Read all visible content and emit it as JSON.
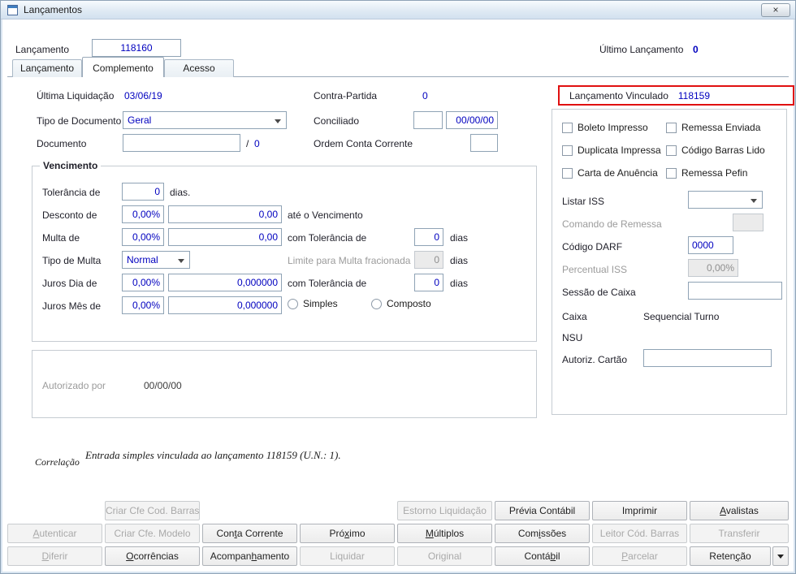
{
  "window": {
    "title": "Lançamentos",
    "close_glyph": "×"
  },
  "header": {
    "lancamento_label": "Lançamento",
    "lancamento_value": "118160",
    "ultimo_label": "Último Lançamento",
    "ultimo_value": "0"
  },
  "tabs": [
    {
      "label": "Lançamento"
    },
    {
      "label": "Complemento"
    },
    {
      "label": "Acesso"
    }
  ],
  "general": {
    "ultima_liquidacao_label": "Última Liquidação",
    "ultima_liquidacao_value": "03/06/19",
    "contra_partida_label": "Contra-Partida",
    "contra_partida_value": "0",
    "tipo_documento_label": "Tipo de Documento",
    "tipo_documento_value": "Geral",
    "conciliado_label": "Conciliado",
    "conciliado_value": "",
    "conciliado_date": "00/00/00",
    "documento_label": "Documento",
    "documento_value": "",
    "documento_sep": "/",
    "documento_seq": "0",
    "ordem_label": "Ordem Conta Corrente",
    "ordem_value": ""
  },
  "vinculado": {
    "label": "Lançamento Vinculado",
    "value": "118159"
  },
  "vencimento": {
    "title": "Vencimento",
    "tolerancia_label": "Tolerância de",
    "tolerancia_value": "0",
    "tolerancia_suffix": "dias.",
    "desconto_label": "Desconto de",
    "desconto_pct": "0,00%",
    "desconto_value": "0,00",
    "desconto_suffix": "até o Vencimento",
    "multa_label": "Multa de",
    "multa_pct": "0,00%",
    "multa_value": "0,00",
    "multa_mid": "com Tolerância de",
    "multa_tol": "0",
    "multa_suffix": "dias",
    "tipo_multa_label": "Tipo de Multa",
    "tipo_multa_value": "Normal",
    "limite_label": "Limite para Multa fracionada",
    "limite_value": "0",
    "limite_suffix": "dias",
    "juros_dia_label": "Juros Dia de",
    "juros_dia_pct": "0,00%",
    "juros_dia_value": "0,000000",
    "juros_dia_mid": "com Tolerância de",
    "juros_dia_tol": "0",
    "juros_dia_suffix": "dias",
    "juros_mes_label": "Juros Mês de",
    "juros_mes_pct": "0,00%",
    "juros_mes_value": "0,000000",
    "radio_simples": "Simples",
    "radio_composto": "Composto"
  },
  "autorizado": {
    "label": "Autorizado por",
    "value": "00/00/00"
  },
  "correlacao": {
    "label": "Correlação",
    "text": "Entrada simples vinculada ao lançamento 118159 (U.N.: 1)."
  },
  "panel": {
    "checkboxes": [
      {
        "label": "Boleto Impresso"
      },
      {
        "label": "Remessa Enviada"
      },
      {
        "label": "Duplicata Impressa"
      },
      {
        "label": "Código Barras Lido"
      },
      {
        "label": "Carta de Anuência"
      },
      {
        "label": "Remessa Pefin"
      }
    ],
    "listar_iss_label": "Listar ISS",
    "listar_iss_value": "",
    "comando_remessa_label": "Comando de Remessa",
    "comando_remessa_value": "",
    "codigo_darf_label": "Código DARF",
    "codigo_darf_value": "0000",
    "percentual_iss_label": "Percentual ISS",
    "percentual_iss_value": "0,00%",
    "sessao_caixa_label": "Sessão de Caixa",
    "sessao_caixa_value": "",
    "caixa_label": "Caixa",
    "caixa_value": "Sequencial Turno",
    "nsu_label": "NSU",
    "autoriz_cartao_label": "Autoriz. Cartão",
    "autoriz_cartao_value": ""
  },
  "buttons": {
    "criar_cod_barras": "Criar Cfe Cod. Barras",
    "estorno_liquidacao": "Estorno Liquidação",
    "previa_contabil": "Prévia Contábil",
    "imprimir": "Imprimir",
    "avalistas": "_Avalistas",
    "autenticar": "_Autenticar",
    "criar_modelo": "Criar Cfe. Modelo",
    "conta_corrente": "Con_ta Corrente",
    "proximo": "Pró_ximo",
    "multiplos": "_Múltiplos",
    "comissoes": "Com_issões",
    "leitor_cod_barras": "Leitor Cód. Barras",
    "transferir": "Transferir",
    "diferir": "_Diferir",
    "ocorrencias": "_Ocorrências",
    "acompanhamento": "Acompan_hamento",
    "liquidar": "Liquidar",
    "original": "Original",
    "contabil": "Contá_bil",
    "parcelar": "_Parcelar",
    "retencao": "Reten_ção"
  },
  "colors": {
    "value_blue": "#0000bf",
    "highlight_red": "#e01010"
  }
}
